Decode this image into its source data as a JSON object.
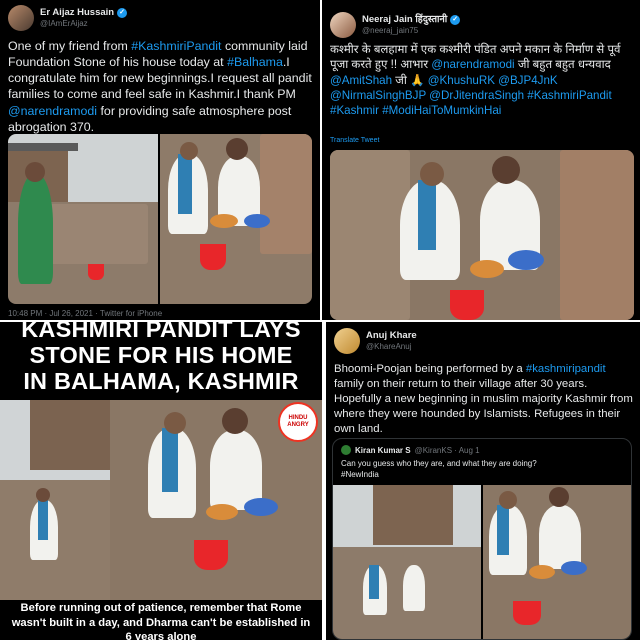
{
  "tweet1": {
    "name": "Er Aijaz Hussain",
    "handle": "@IAmErAijaz",
    "text_parts": [
      {
        "t": "One of my friend from ",
        "link": false
      },
      {
        "t": "#KashmiriPandit",
        "link": true
      },
      {
        "t": " community laid Foundation Stone of his house today at ",
        "link": false
      },
      {
        "t": "#Balhama",
        "link": true
      },
      {
        "t": ".I congratulate him for new beginnings.I request all pandit families to come and feel safe in Kashmir.I thank PM ",
        "link": false
      },
      {
        "t": "@narendramodi",
        "link": true
      },
      {
        "t": " for providing safe atmosphere post abrogation 370.",
        "link": false
      }
    ],
    "meta": "10:48 PM · Jul 26, 2021 · Twitter for iPhone"
  },
  "tweet2": {
    "name": "Neeraj Jain हिंदुस्तानी",
    "handle": "@neeraj_jain75",
    "text_parts": [
      {
        "t": "कश्मीर के बलहामा में एक कश्मीरी पंडित अपने मकान के निर्माण से पूर्व पूजा करते हुए !! आभार ",
        "link": false
      },
      {
        "t": "@narendramodi",
        "link": true
      },
      {
        "t": " जी बहुत बहुत धन्यवाद ",
        "link": false
      },
      {
        "t": "@AmitShah",
        "link": true
      },
      {
        "t": " जी 🙏 ",
        "link": false
      },
      {
        "t": "@KhushuRK @BJP4JnK @NirmalSinghBJP @DrJitendraSingh #KashmiriPandit #Kashmir #ModiHaiToMumkinHai",
        "link": true
      }
    ],
    "translate": "Translate Tweet"
  },
  "tweet3": {
    "name": "Anuj Khare",
    "handle": "@KhareAnuj",
    "text_parts": [
      {
        "t": "Bhoomi-Poojan being performed by a ",
        "link": false
      },
      {
        "t": "#kashmiripandit",
        "link": true
      },
      {
        "t": " family on their return to their village after 30 years. Hopefully a new beginning in muslim majority Kashmir from where they were hounded by Islamists. Refugees in their own land.",
        "link": false
      }
    ],
    "quote": {
      "name": "Kiran Kumar S",
      "handle": "@KiranKS · Aug 1",
      "text": "Can you guess who they are, and what they are doing?",
      "hashtag": "#NewIndia"
    }
  },
  "banner": {
    "title_lines": [
      "KASHMIRI PANDIT LAYS",
      "STONE FOR HIS HOME",
      "IN BALHAMA, KASHMIR"
    ],
    "logo_text": "HINDU ANGRY",
    "caption": "Before running out of patience, remember that Rome wasn't built in a day, and Dharma can't be established in 6 years alone"
  },
  "colors": {
    "link": "#1d9bf0",
    "bg": "#000000",
    "banner_text": "#ffffff",
    "divider": "#e6b800"
  }
}
